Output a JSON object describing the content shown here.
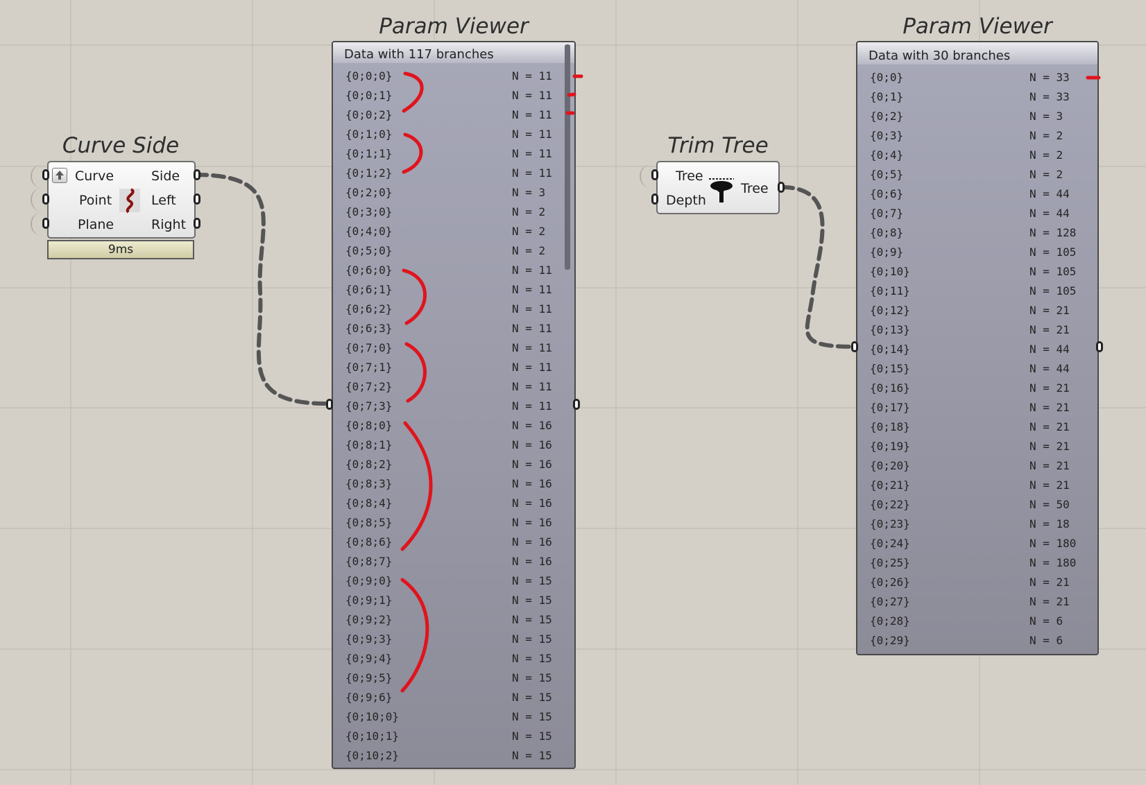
{
  "curve_side": {
    "title": "Curve Side",
    "inputs": [
      "Curve",
      "Point",
      "Plane"
    ],
    "outputs": [
      "Side",
      "Left",
      "Right"
    ],
    "timer": "9ms"
  },
  "trim_tree": {
    "title": "Trim Tree",
    "inputs": [
      "Tree",
      "Depth"
    ],
    "outputs": [
      "Tree"
    ]
  },
  "viewer1": {
    "title": "Param Viewer",
    "header": "Data with 117 branches",
    "rows": [
      {
        "path": "{0;0;0}",
        "n": "N = 11"
      },
      {
        "path": "{0;0;1}",
        "n": "N = 11"
      },
      {
        "path": "{0;0;2}",
        "n": "N = 11"
      },
      {
        "path": "{0;1;0}",
        "n": "N = 11"
      },
      {
        "path": "{0;1;1}",
        "n": "N = 11"
      },
      {
        "path": "{0;1;2}",
        "n": "N = 11"
      },
      {
        "path": "{0;2;0}",
        "n": "N = 3"
      },
      {
        "path": "{0;3;0}",
        "n": "N = 2"
      },
      {
        "path": "{0;4;0}",
        "n": "N = 2"
      },
      {
        "path": "{0;5;0}",
        "n": "N = 2"
      },
      {
        "path": "{0;6;0}",
        "n": "N = 11"
      },
      {
        "path": "{0;6;1}",
        "n": "N = 11"
      },
      {
        "path": "{0;6;2}",
        "n": "N = 11"
      },
      {
        "path": "{0;6;3}",
        "n": "N = 11"
      },
      {
        "path": "{0;7;0}",
        "n": "N = 11"
      },
      {
        "path": "{0;7;1}",
        "n": "N = 11"
      },
      {
        "path": "{0;7;2}",
        "n": "N = 11"
      },
      {
        "path": "{0;7;3}",
        "n": "N = 11"
      },
      {
        "path": "{0;8;0}",
        "n": "N = 16"
      },
      {
        "path": "{0;8;1}",
        "n": "N = 16"
      },
      {
        "path": "{0;8;2}",
        "n": "N = 16"
      },
      {
        "path": "{0;8;3}",
        "n": "N = 16"
      },
      {
        "path": "{0;8;4}",
        "n": "N = 16"
      },
      {
        "path": "{0;8;5}",
        "n": "N = 16"
      },
      {
        "path": "{0;8;6}",
        "n": "N = 16"
      },
      {
        "path": "{0;8;7}",
        "n": "N = 16"
      },
      {
        "path": "{0;9;0}",
        "n": "N = 15"
      },
      {
        "path": "{0;9;1}",
        "n": "N = 15"
      },
      {
        "path": "{0;9;2}",
        "n": "N = 15"
      },
      {
        "path": "{0;9;3}",
        "n": "N = 15"
      },
      {
        "path": "{0;9;4}",
        "n": "N = 15"
      },
      {
        "path": "{0;9;5}",
        "n": "N = 15"
      },
      {
        "path": "{0;9;6}",
        "n": "N = 15"
      },
      {
        "path": "{0;10;0}",
        "n": "N = 15"
      },
      {
        "path": "{0;10;1}",
        "n": "N = 15"
      },
      {
        "path": "{0;10;2}",
        "n": "N = 15"
      }
    ]
  },
  "viewer2": {
    "title": "Param Viewer",
    "header": "Data with 30 branches",
    "rows": [
      {
        "path": "{0;0}",
        "n": "N = 33"
      },
      {
        "path": "{0;1}",
        "n": "N = 33"
      },
      {
        "path": "{0;2}",
        "n": "N = 3"
      },
      {
        "path": "{0;3}",
        "n": "N = 2"
      },
      {
        "path": "{0;4}",
        "n": "N = 2"
      },
      {
        "path": "{0;5}",
        "n": "N = 2"
      },
      {
        "path": "{0;6}",
        "n": "N = 44"
      },
      {
        "path": "{0;7}",
        "n": "N = 44"
      },
      {
        "path": "{0;8}",
        "n": "N = 128"
      },
      {
        "path": "{0;9}",
        "n": "N = 105"
      },
      {
        "path": "{0;10}",
        "n": "N = 105"
      },
      {
        "path": "{0;11}",
        "n": "N = 105"
      },
      {
        "path": "{0;12}",
        "n": "N = 21"
      },
      {
        "path": "{0;13}",
        "n": "N = 21"
      },
      {
        "path": "{0;14}",
        "n": "N = 44"
      },
      {
        "path": "{0;15}",
        "n": "N = 44"
      },
      {
        "path": "{0;16}",
        "n": "N = 21"
      },
      {
        "path": "{0;17}",
        "n": "N = 21"
      },
      {
        "path": "{0;18}",
        "n": "N = 21"
      },
      {
        "path": "{0;19}",
        "n": "N = 21"
      },
      {
        "path": "{0;20}",
        "n": "N = 21"
      },
      {
        "path": "{0;21}",
        "n": "N = 21"
      },
      {
        "path": "{0;22}",
        "n": "N = 50"
      },
      {
        "path": "{0;23}",
        "n": "N = 18"
      },
      {
        "path": "{0;24}",
        "n": "N = 180"
      },
      {
        "path": "{0;25}",
        "n": "N = 180"
      },
      {
        "path": "{0;26}",
        "n": "N = 21"
      },
      {
        "path": "{0;27}",
        "n": "N = 21"
      },
      {
        "path": "{0;28}",
        "n": "N = 6"
      },
      {
        "path": "{0;29}",
        "n": "N = 6"
      }
    ]
  },
  "colors": {
    "canvas": "#d4d0c8",
    "annotation": "#e0141c",
    "wire": "#555555"
  },
  "icons": [
    "curve-side-icon",
    "trim-tree-icon",
    "input-arrow-icon"
  ]
}
